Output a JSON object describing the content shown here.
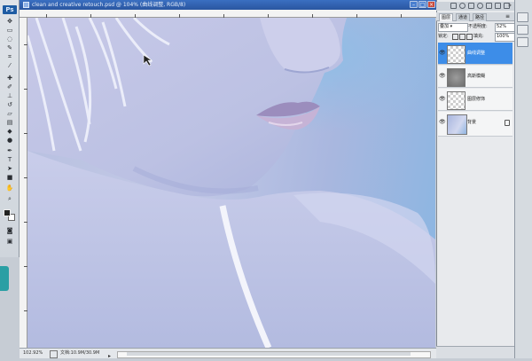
{
  "document": {
    "title": "clean and creative retouch.psd @ 104% (曲线调整, RGB/8)",
    "zoom": "102.92%",
    "doc_info": "文档:10.9M/30.9M"
  },
  "tools_panel": {
    "logo": "Ps",
    "tools": [
      "move-icon",
      "marquee-icon",
      "lasso-icon",
      "quick-select-icon",
      "crop-icon",
      "eyedropper-icon",
      "healing-brush-icon",
      "brush-icon",
      "clone-stamp-icon",
      "history-brush-icon",
      "eraser-icon",
      "gradient-icon",
      "blur-icon",
      "dodge-icon",
      "pen-icon",
      "type-icon",
      "path-select-icon",
      "shape-icon",
      "hand-icon",
      "zoom-icon"
    ]
  },
  "layers_panel": {
    "tabs": [
      "图层",
      "通道",
      "路径"
    ],
    "blend_mode": "叠加",
    "opacity_label": "不透明度:",
    "opacity_value": "52%",
    "lock_label": "锁定:",
    "fill_label": "填充:",
    "fill_value": "100%",
    "layers": [
      {
        "name": "曲线调整",
        "visible": true,
        "selected": true,
        "thumb": "checker"
      },
      {
        "name": "高斯模糊",
        "visible": true,
        "selected": false,
        "thumb": "gray"
      },
      {
        "name": "图层修饰",
        "visible": true,
        "selected": false,
        "thumb": "checker"
      },
      {
        "name": "背景",
        "visible": true,
        "selected": false,
        "thumb": "photo",
        "locked": true
      }
    ]
  },
  "colors": {
    "selected_layer": "#3d8de8",
    "title_bar": "#2a56a0",
    "canvas_tint": "#b7c0e0"
  }
}
